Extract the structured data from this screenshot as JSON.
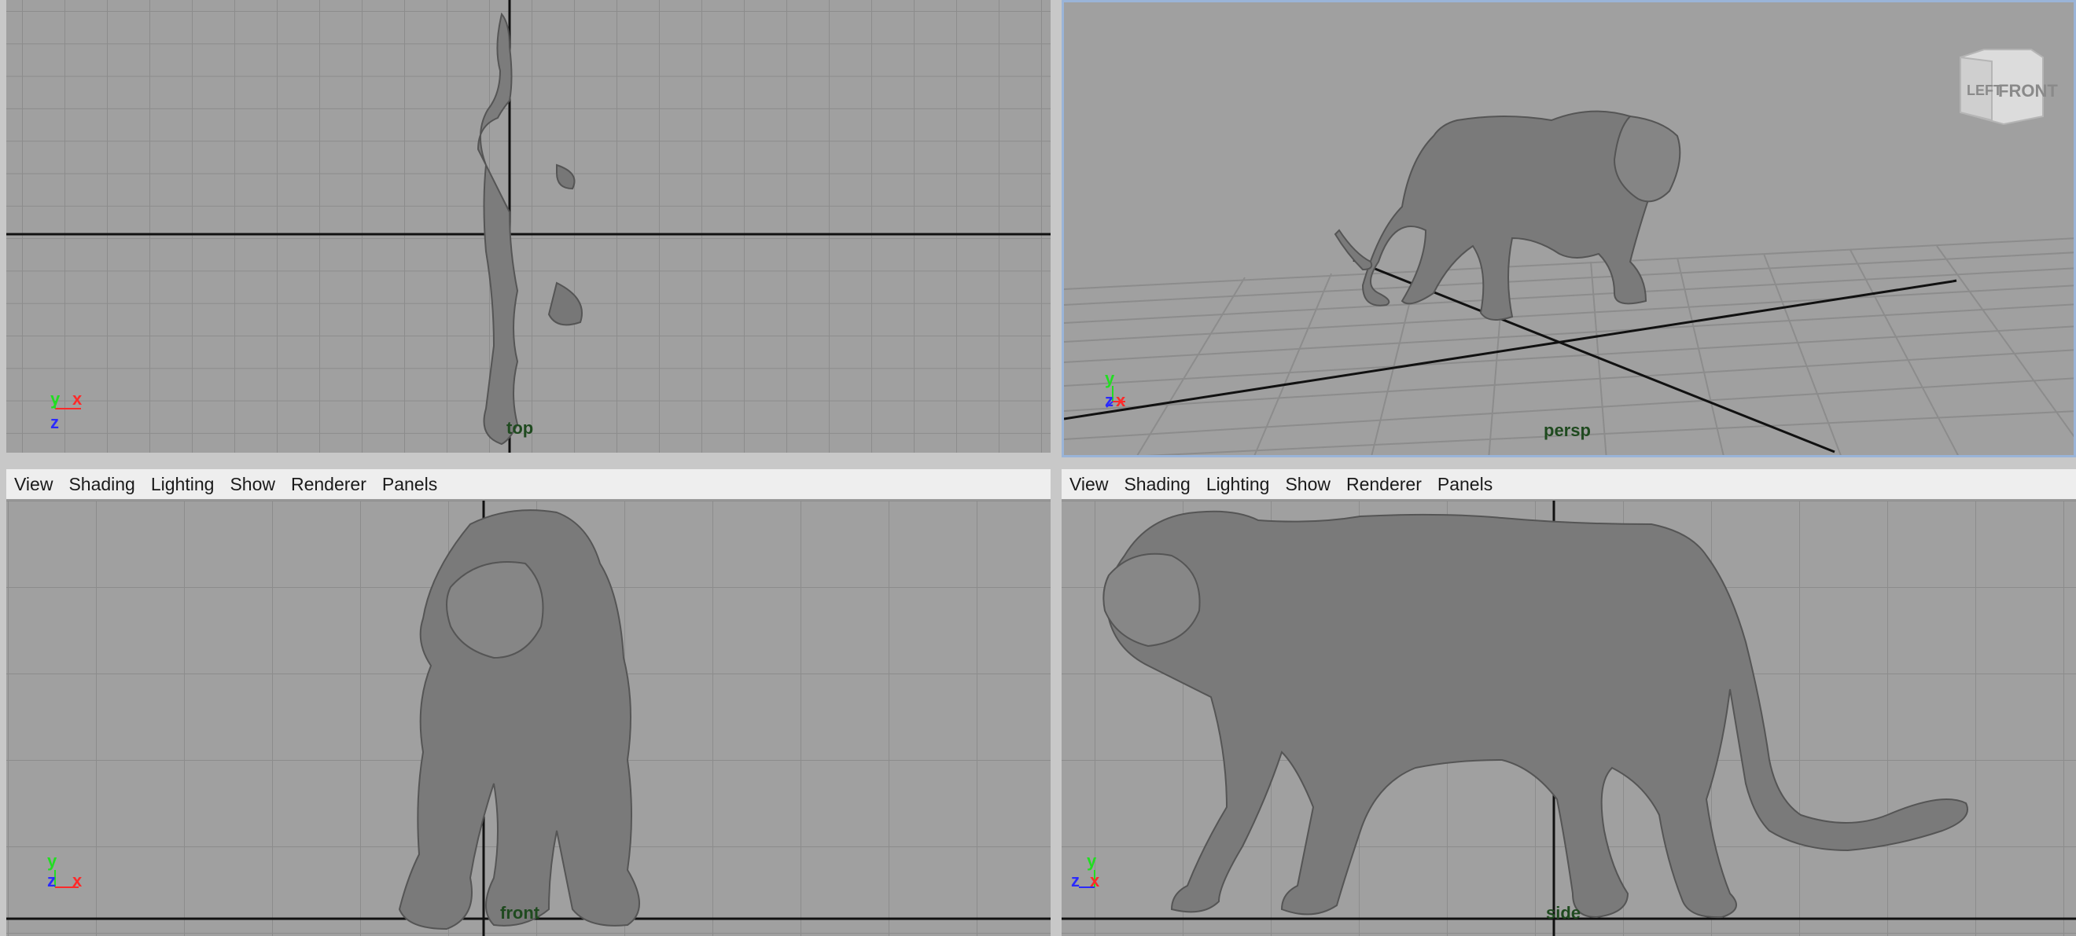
{
  "menu": {
    "items": [
      {
        "label": "View"
      },
      {
        "label": "Shading"
      },
      {
        "label": "Lighting"
      },
      {
        "label": "Show"
      },
      {
        "label": "Renderer"
      },
      {
        "label": "Panels"
      }
    ]
  },
  "panels": {
    "top": {
      "camera": "top"
    },
    "persp": {
      "camera": "persp"
    },
    "front": {
      "camera": "front"
    },
    "side": {
      "camera": "side"
    }
  },
  "axes": {
    "x": "x",
    "y": "y",
    "z": "z"
  },
  "view_cube": {
    "left": "LEFT",
    "front": "FRONT"
  },
  "colors": {
    "viewport_bg": "#a0a0a0",
    "grid": "#8c8c8c",
    "axis_line": "#111111",
    "model": "#808080",
    "x_axis": "#ff2a2a",
    "y_axis": "#22dd22",
    "z_axis": "#2a2aff",
    "active_border": "#9ab4d8"
  }
}
